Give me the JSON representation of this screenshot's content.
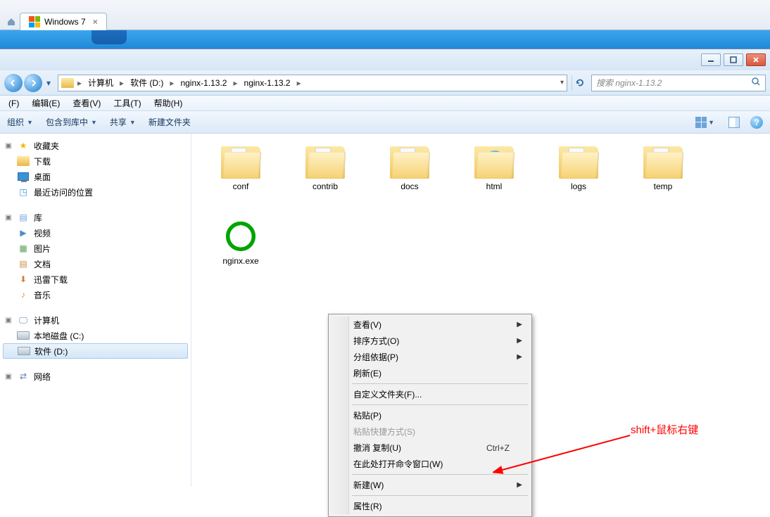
{
  "vm_tab": {
    "title": "Windows 7"
  },
  "window_controls": {
    "min": "minimize",
    "max": "maximize",
    "close": "close"
  },
  "breadcrumb": {
    "root": "计算机",
    "drive": "软件 (D:)",
    "folder1": "nginx-1.13.2",
    "folder2": "nginx-1.13.2"
  },
  "search": {
    "placeholder": "搜索 nginx-1.13.2"
  },
  "menubar": {
    "file": "(F)",
    "edit": "编辑(E)",
    "view": "查看(V)",
    "tools": "工具(T)",
    "help": "帮助(H)"
  },
  "toolbar": {
    "organize": "组织",
    "include": "包含到库中",
    "share": "共享",
    "new_folder": "新建文件夹"
  },
  "sidebar": {
    "favorites": "收藏夹",
    "downloads": "下载",
    "desktop": "桌面",
    "recent": "最近访问的位置",
    "libraries": "库",
    "video": "视频",
    "pictures": "图片",
    "documents": "文档",
    "xunlei": "迅雷下载",
    "music": "音乐",
    "computer": "计算机",
    "drive_c": "本地磁盘 (C:)",
    "drive_d": "软件 (D:)",
    "network": "网络"
  },
  "files": [
    {
      "name": "conf",
      "type": "folder"
    },
    {
      "name": "contrib",
      "type": "folder"
    },
    {
      "name": "docs",
      "type": "folder"
    },
    {
      "name": "html",
      "type": "folder-html"
    },
    {
      "name": "logs",
      "type": "folder"
    },
    {
      "name": "temp",
      "type": "folder"
    },
    {
      "name": "nginx.exe",
      "type": "exe"
    }
  ],
  "context_menu": {
    "view": "查看(V)",
    "sort": "排序方式(O)",
    "group": "分组依据(P)",
    "refresh": "刷新(E)",
    "customize": "自定义文件夹(F)...",
    "paste": "粘贴(P)",
    "paste_shortcut": "粘贴快捷方式(S)",
    "undo": "撤消 复制(U)",
    "undo_key": "Ctrl+Z",
    "open_cmd": "在此处打开命令窗口(W)",
    "new": "新建(W)",
    "properties": "属性(R)"
  },
  "annotation": {
    "text": "shift+鼠标右键"
  }
}
